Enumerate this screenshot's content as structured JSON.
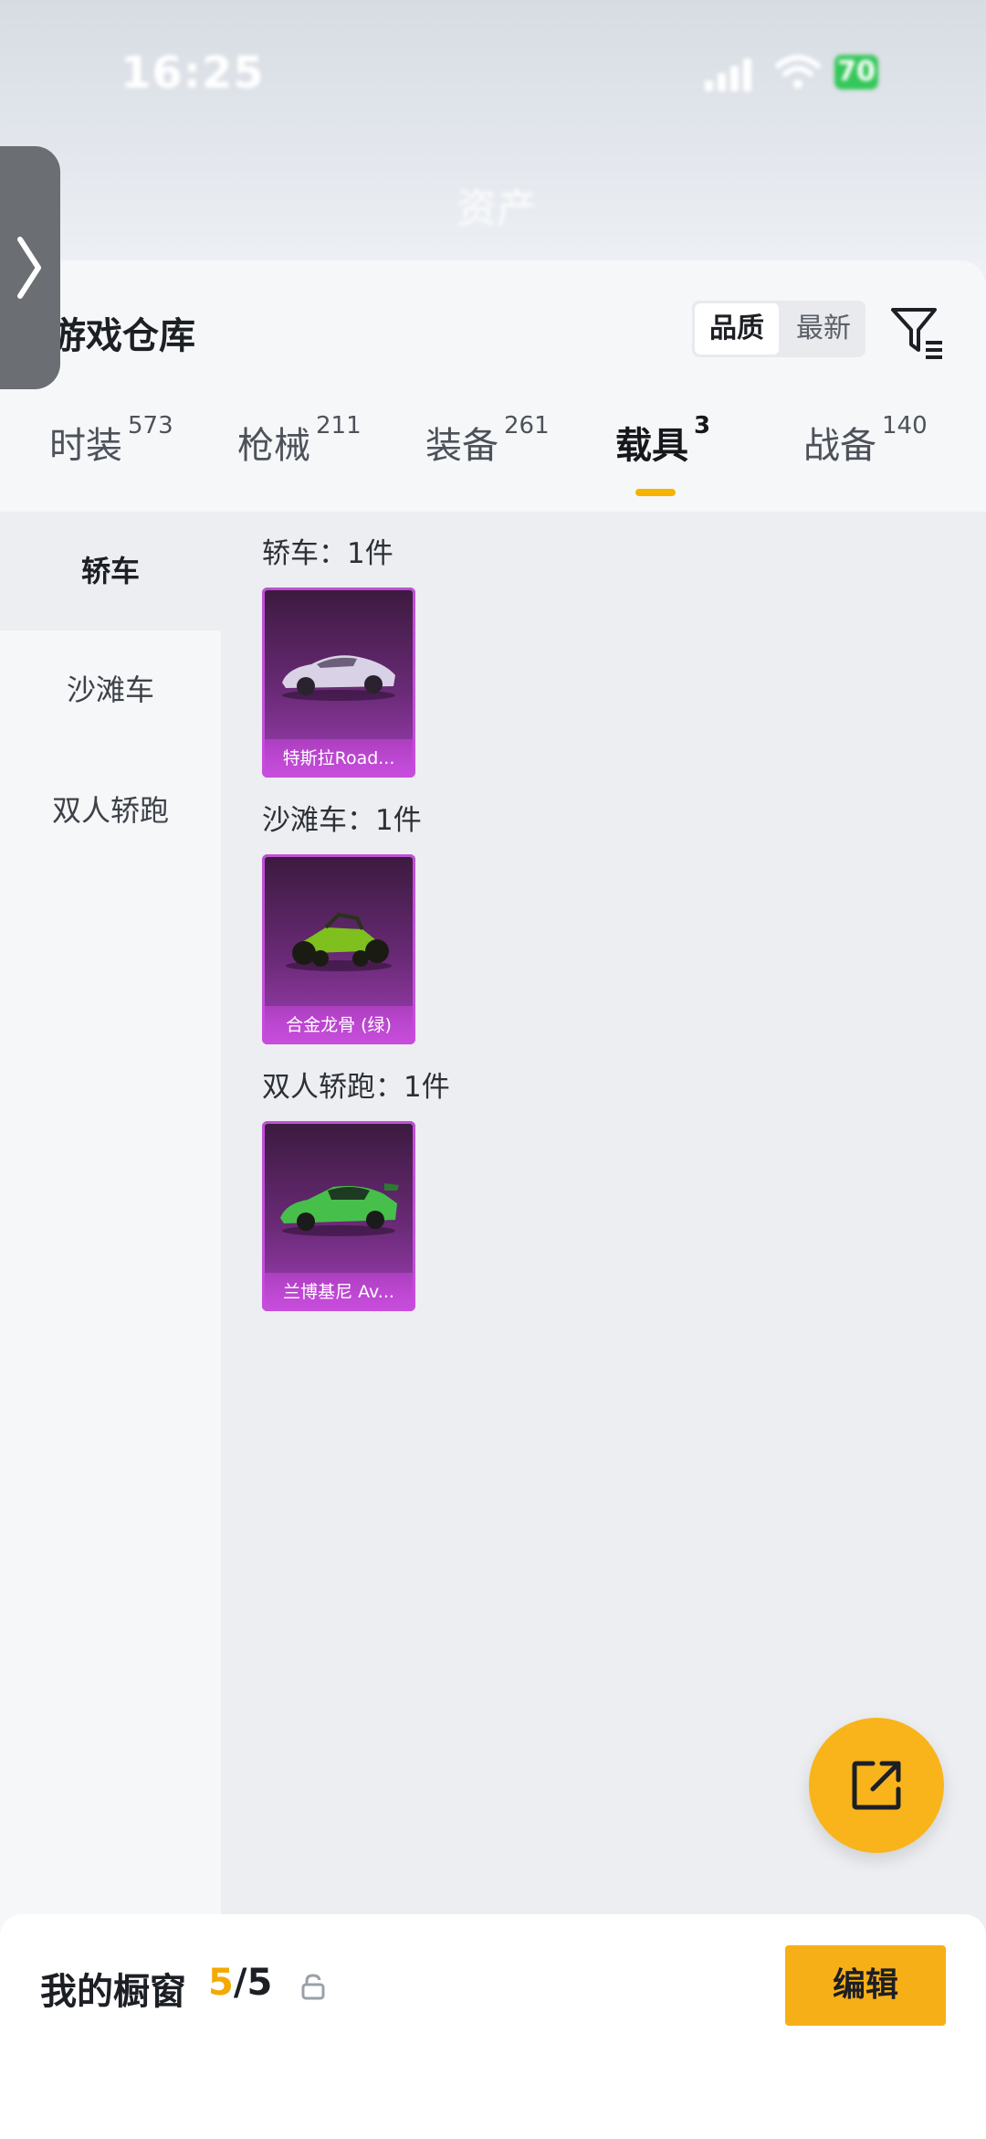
{
  "status_bar": {
    "time": "16:25",
    "battery": "70"
  },
  "background": {
    "asset_title": "资产"
  },
  "sheet": {
    "title": "游戏仓库",
    "sort": {
      "quality_label": "品质",
      "latest_label": "最新"
    }
  },
  "tabs": [
    {
      "label": "时装",
      "count": "573"
    },
    {
      "label": "枪械",
      "count": "211"
    },
    {
      "label": "装备",
      "count": "261"
    },
    {
      "label": "载具",
      "count": "3"
    },
    {
      "label": "战备",
      "count": "140"
    }
  ],
  "active_tab_index": 3,
  "categories": [
    {
      "label": "轿车"
    },
    {
      "label": "沙滩车"
    },
    {
      "label": "双人轿跑"
    }
  ],
  "sections": [
    {
      "title": "轿车：1件",
      "item_name": "特斯拉Road...",
      "car_color": "#d9d2e6"
    },
    {
      "title": "沙滩车：1件",
      "item_name": "合金龙骨 (绿)",
      "car_color": "#7fbf1e"
    },
    {
      "title": "双人轿跑：1件",
      "item_name": "兰博基尼 Av...",
      "car_color": "#46c04a"
    }
  ],
  "bottom_bar": {
    "showcase_label": "我的橱窗",
    "current": "5",
    "total": "/5",
    "edit_label": "编辑"
  },
  "colors": {
    "accent": "#f7af17",
    "card_border": "#c04fd6"
  }
}
